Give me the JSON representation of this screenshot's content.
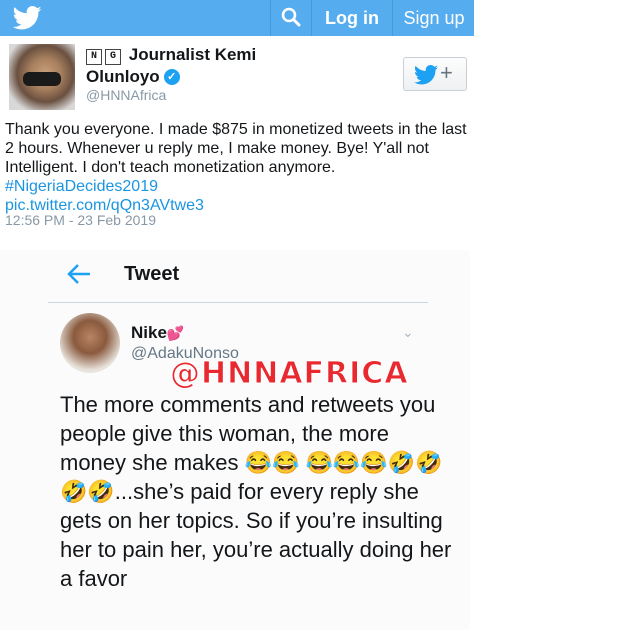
{
  "header": {
    "logo_icon": "twitter-bird-icon",
    "search_icon": "search-icon",
    "login_label": "Log in",
    "signup_label": "Sign up",
    "bg_color": "#55acee"
  },
  "tweet": {
    "badge_n": "N",
    "badge_g": "G",
    "name": "Journalist Kemi Olunloyo",
    "handle": "@HNNAfrica",
    "text": "Thank you everyone. I made $875 in monetized tweets in the last 2 hours. Whenever u reply me, I make money. Bye! Y'all not Intelligent. I don't teach monetization anymore.",
    "hashtag": "#NigeriaDecides2019",
    "pic_link": "pic.twitter.com/qQn3AVtwe3",
    "timestamp": "12:56 PM - 23 Feb 2019",
    "follow_icon": "follow-bird-plus-icon"
  },
  "screenshot": {
    "title": "Tweet",
    "name": "Nike",
    "name_emoji": "💕",
    "handle": "@AdakuNonso",
    "watermark": "@HNNAFRICA",
    "body": "The more comments and retweets you people give this woman, the more money she makes 😂😂 😂😂😂🤣🤣🤣🤣...she’s paid for every reply she gets on her topics. So if you’re insulting her to pain her, you’re actually doing her a favor"
  }
}
